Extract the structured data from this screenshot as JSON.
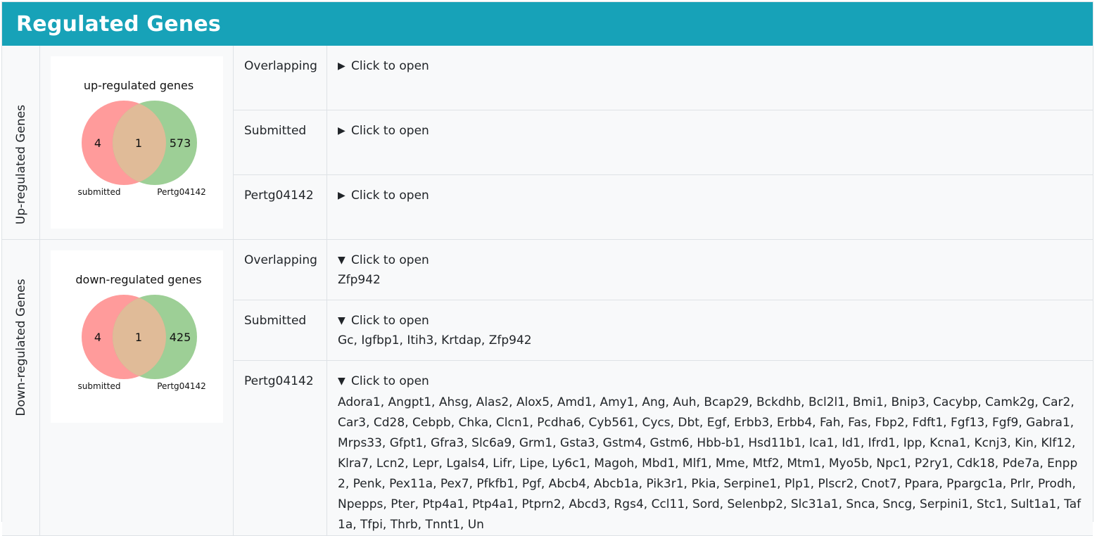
{
  "header": {
    "title": "Regulated Genes"
  },
  "sections": {
    "up": {
      "label": "Up-regulated Genes",
      "venn": {
        "title": "up-regulated genes",
        "left_only": "4",
        "overlap": "1",
        "right_only": "573",
        "left_label": "submitted",
        "right_label": "Pertg04142"
      },
      "rows": [
        {
          "name": "Overlapping",
          "toggle": "Click to open"
        },
        {
          "name": "Submitted",
          "toggle": "Click to open"
        },
        {
          "name": "Pertg04142",
          "toggle": "Click to open"
        }
      ]
    },
    "down": {
      "label": "Down-regulated Genes",
      "venn": {
        "title": "down-regulated genes",
        "left_only": "4",
        "overlap": "1",
        "right_only": "425",
        "left_label": "submitted",
        "right_label": "Pertg04142"
      },
      "rows": [
        {
          "name": "Overlapping",
          "toggle": "Click to open",
          "genes": "Zfp942"
        },
        {
          "name": "Submitted",
          "toggle": "Click to open",
          "genes": "Gc, Igfbp1, Itih3, Krtdap, Zfp942"
        },
        {
          "name": "Pertg04142",
          "toggle": "Click to open",
          "genes": "Adora1, Angpt1, Ahsg, Alas2, Alox5, Amd1, Amy1, Ang, Auh, Bcap29, Bckdhb, Bcl2l1, Bmi1, Bnip3, Cacybp, Camk2g, Car2, Car3, Cd28, Cebpb, Chka, Clcn1, Pcdha6, Cyb561, Cycs, Dbt, Egf, Erbb3, Erbb4, Fah, Fas, Fbp2, Fdft1, Fgf13, Fgf9, Gabra1, Mrps33, Gfpt1, Gfra3, Slc6a9, Grm1, Gsta3, Gstm4, Gstm6, Hbb-b1, Hsd11b1, Ica1, Id1, Ifrd1, Ipp, Kcna1, Kcnj3, Kin, Klf12, Klra7, Lcn2, Lepr, Lgals4, Lifr, Lipe, Ly6c1, Magoh, Mbd1, Mlf1, Mme, Mtf2, Mtm1, Myo5b, Npc1, P2ry1, Cdk18, Pde7a, Enpp2, Penk, Pex11a, Pex7, Pfkfb1, Pgf, Abcb4, Abcb1a, Pik3r1, Pkia, Serpine1, Plp1, Plscr2, Cnot7, Ppara, Ppargc1a, Prlr, Prodh, Npepps, Pter, Ptp4a1, Ptp4a1, Ptprn2, Abcd3, Rgs4, Ccl11, Sord, Selenbp2, Slc31a1, Snca, Sncg, Serpini1, Stc1, Sult1a1, Taf1a, Tfpi, Thrb, Tnnt1, Un"
        }
      ]
    }
  },
  "colors": {
    "header_bg": "#17a2b8",
    "venn_left": "#ff8a8a",
    "venn_right": "#8cc784",
    "venn_overlap": "#e0bb98"
  },
  "icons": {
    "collapsed": "triangle-right-icon",
    "expanded": "triangle-down-icon"
  }
}
